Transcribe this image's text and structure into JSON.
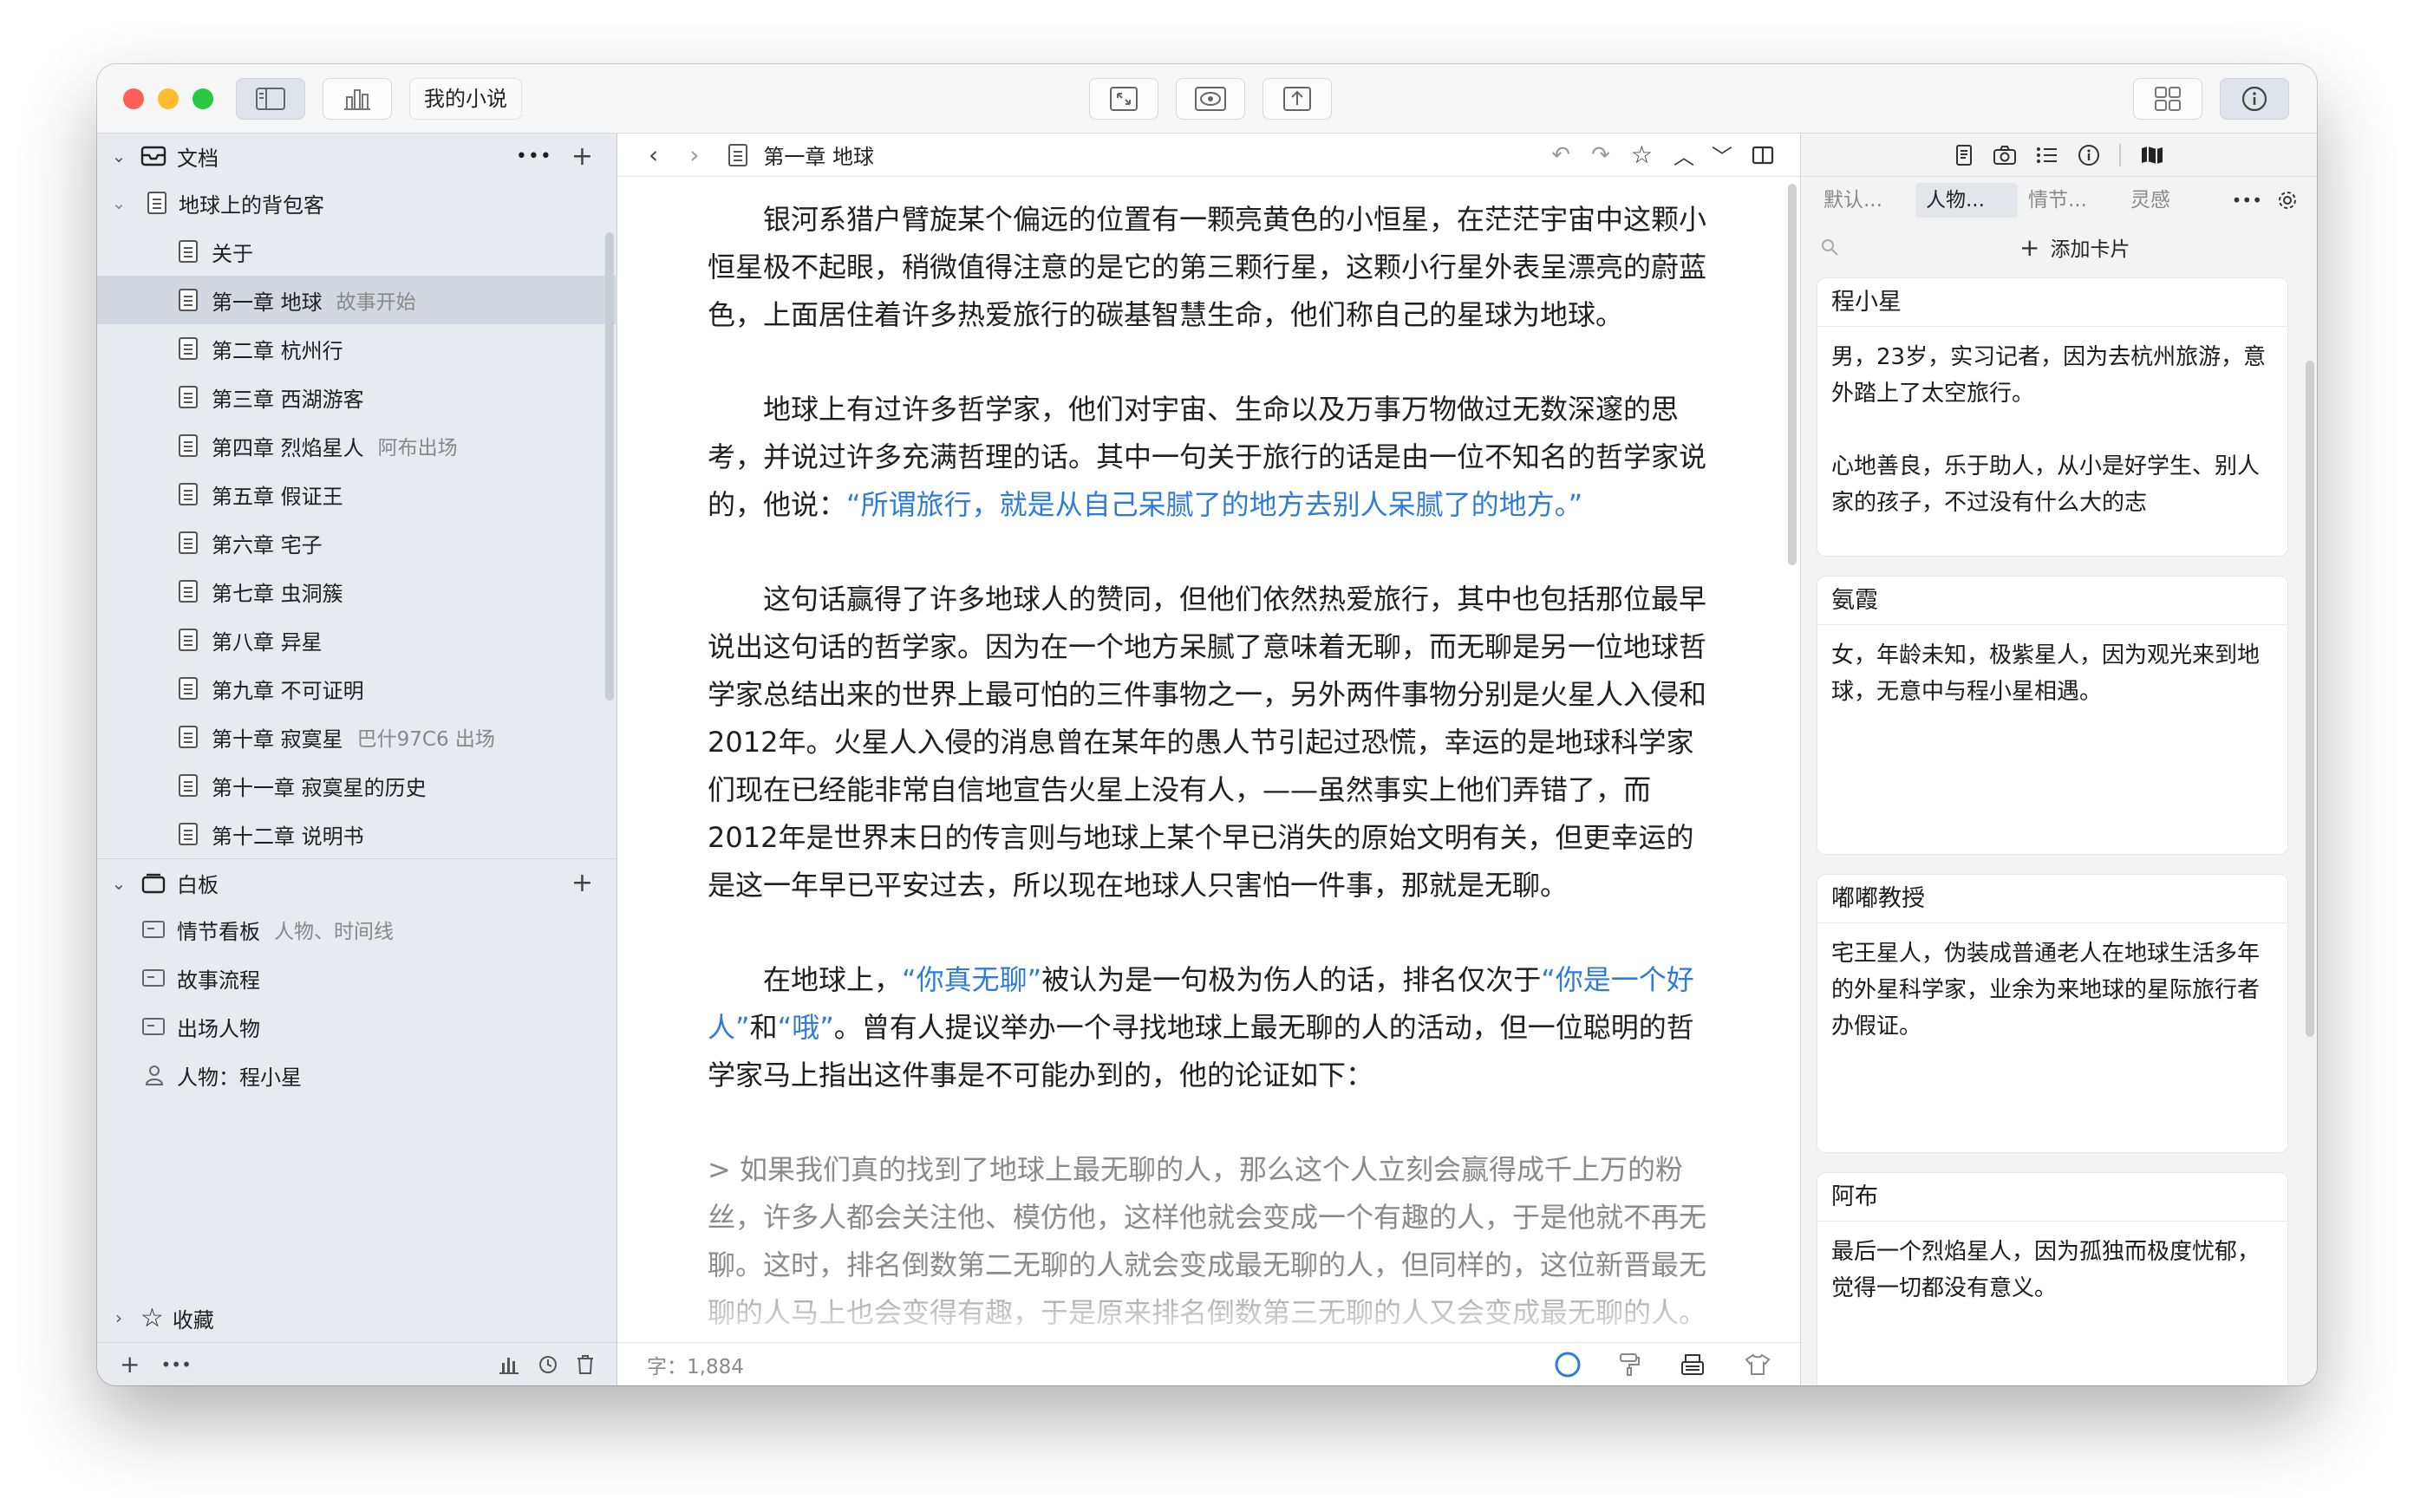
{
  "titlebar": {
    "project_title": "我的小说",
    "icons": [
      "sidebar-toggle-icon",
      "statistics-icon",
      "fullscreen-icon",
      "preview-icon",
      "share-icon",
      "grid-view-icon",
      "info-icon"
    ]
  },
  "sidebar": {
    "documents_header": "文档",
    "group_name": "地球上的背包客",
    "items": [
      {
        "label": "关于",
        "sub": ""
      },
      {
        "label": "第一章 地球",
        "sub": "故事开始"
      },
      {
        "label": "第二章 杭州行",
        "sub": ""
      },
      {
        "label": "第三章 西湖游客",
        "sub": ""
      },
      {
        "label": "第四章 烈焰星人",
        "sub": "阿布出场"
      },
      {
        "label": "第五章 假证王",
        "sub": ""
      },
      {
        "label": "第六章 宅子",
        "sub": ""
      },
      {
        "label": "第七章 虫洞簇",
        "sub": ""
      },
      {
        "label": "第八章 异星",
        "sub": ""
      },
      {
        "label": "第九章 不可证明",
        "sub": ""
      },
      {
        "label": "第十章 寂寞星",
        "sub": "巴什97C6 出场"
      },
      {
        "label": "第十一章 寂寞星的历史",
        "sub": ""
      },
      {
        "label": "第十二章 说明书",
        "sub": ""
      }
    ],
    "whiteboard_header": "白板",
    "whiteboard_items": [
      {
        "label": "情节看板",
        "sub": "人物、时间线"
      },
      {
        "label": "故事流程",
        "sub": ""
      },
      {
        "label": "出场人物",
        "sub": ""
      },
      {
        "label": "人物：程小星",
        "sub": ""
      }
    ],
    "favorites_header": "收藏"
  },
  "editor": {
    "doc_title": "第一章 地球",
    "paragraphs": {
      "p1": "银河系猎户臂旋某个偏远的位置有一颗亮黄色的小恒星，在茫茫宇宙中这颗小恒星极不起眼，稍微值得注意的是它的第三颗行星，这颗小行星外表呈漂亮的蔚蓝色，上面居住着许多热爱旅行的碳基智慧生命，他们称自己的星球为地球。",
      "p2a": "地球上有过许多哲学家，他们对宇宙、生命以及万事万物做过无数深邃的思考，并说过许多充满哲理的话。其中一句关于旅行的话是由一位不知名的哲学家说的，他说：",
      "p2q": "“所谓旅行，就是从自己呆腻了的地方去别人呆腻了的地方。”",
      "p3": "这句话赢得了许多地球人的赞同，但他们依然热爱旅行，其中也包括那位最早说出这句话的哲学家。因为在一个地方呆腻了意味着无聊，而无聊是另一位地球哲学家总结出来的世界上最可怕的三件事物之一，另外两件事物分别是火星人入侵和2012年。火星人入侵的消息曾在某年的愚人节引起过恐慌，幸运的是地球科学家们现在已经能非常自信地宣告火星上没有人，——虽然事实上他们弄错了，而2012年是世界末日的传言则与地球上某个早已消失的原始文明有关，但更幸运的是这一年早已平安过去，所以现在地球人只害怕一件事，那就是无聊。",
      "p4a": "在地球上，",
      "p4q1": "“你真无聊”",
      "p4b": "被认为是一句极为伤人的话，排名仅次于",
      "p4q2": "“你是一个好人”",
      "p4c": "和",
      "p4q3": "“哦”",
      "p4d": "。曾有人提议举办一个寻找地球上最无聊的人的活动，但一位聪明的哲学家马上指出这件事是不可能办到的，他的论证如下：",
      "quote": "> 如果我们真的找到了地球上最无聊的人，那么这个人立刻会赢得成千上万的粉丝，许多人都会关注他、模仿他，这样他就会变成一个有趣的人，于是他就不再无聊。这时，排名倒数第二无聊的人就会变成最无聊的人，但同样的，这位新晋最无聊的人马上也会变得有趣，于是原来排名倒数第三无聊的人又会变成最无聊的人。"
    },
    "word_count": "字：1,884"
  },
  "inspector": {
    "tabs": [
      "默认...",
      "人物...",
      "情节...",
      "灵感"
    ],
    "add_card": "添加卡片",
    "cards": [
      {
        "title": "程小星",
        "body1": "男，23岁，实习记者，因为去杭州旅游，意外踏上了太空旅行。",
        "body2": "心地善良，乐于助人，从小是好学生、别人家的孩子，不过没有什么大的志"
      },
      {
        "title": "氨霞",
        "body1": "女，年龄未知，极紫星人，因为观光来到地球，无意中与程小星相遇。",
        "body2": ""
      },
      {
        "title": "嘟嘟教授",
        "body1": "宅王星人，伪装成普通老人在地球生活多年的外星科学家，业余为来地球的星际旅行者办假证。",
        "body2": ""
      },
      {
        "title": "阿布",
        "body1": "最后一个烈焰星人，因为孤独而极度忧郁，觉得一切都没有意义。",
        "body2": ""
      }
    ]
  },
  "colors": {
    "link": "#2f7bd8",
    "sidebar_bg": "#e7eaef",
    "selected_row": "#d3d8e0",
    "close": "#fe5f57",
    "minimize": "#febc2e",
    "zoom": "#28c840"
  }
}
